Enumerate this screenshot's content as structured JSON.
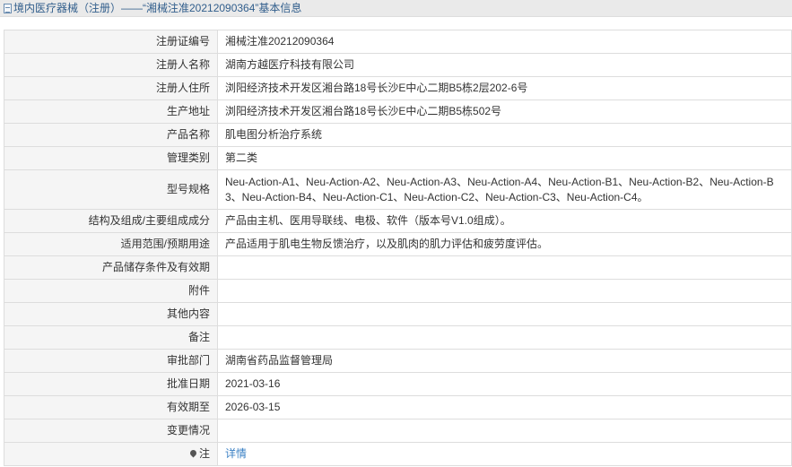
{
  "header": {
    "title": "境内医疗器械（注册）——“湘械注准20212090364”基本信息"
  },
  "rows": [
    {
      "label": "注册证编号",
      "value": "湘械注准20212090364"
    },
    {
      "label": "注册人名称",
      "value": "湖南方越医疗科技有限公司"
    },
    {
      "label": "注册人住所",
      "value": "浏阳经济技术开发区湘台路18号长沙E中心二期B5栋2层202-6号"
    },
    {
      "label": "生产地址",
      "value": "浏阳经济技术开发区湘台路18号长沙E中心二期B5栋502号"
    },
    {
      "label": "产品名称",
      "value": "肌电图分析治疗系统"
    },
    {
      "label": "管理类别",
      "value": "第二类"
    },
    {
      "label": "型号规格",
      "value": "Neu-Action-A1、Neu-Action-A2、Neu-Action-A3、Neu-Action-A4、Neu-Action-B1、Neu-Action-B2、Neu-Action-B3、Neu-Action-B4、Neu-Action-C1、Neu-Action-C2、Neu-Action-C3、Neu-Action-C4。"
    },
    {
      "label": "结构及组成/主要组成成分",
      "value": "产品由主机、医用导联线、电极、软件（版本号V1.0组成）。"
    },
    {
      "label": "适用范围/预期用途",
      "value": "产品适用于肌电生物反馈治疗，以及肌肉的肌力评估和疲劳度评估。"
    },
    {
      "label": "产品储存条件及有效期",
      "value": ""
    },
    {
      "label": "附件",
      "value": ""
    },
    {
      "label": "其他内容",
      "value": ""
    },
    {
      "label": "备注",
      "value": ""
    },
    {
      "label": "审批部门",
      "value": "湖南省药品监督管理局"
    },
    {
      "label": "批准日期",
      "value": "2021-03-16"
    },
    {
      "label": "有效期至",
      "value": "2026-03-15"
    },
    {
      "label": "变更情况",
      "value": ""
    }
  ],
  "note_row": {
    "label": "注",
    "link_text": "详情",
    "icon": "location-pin-icon"
  },
  "colors": {
    "title_text": "#315e8c",
    "label_bg": "#f5f5f5",
    "border": "#dddddd",
    "link": "#3a80c4"
  }
}
